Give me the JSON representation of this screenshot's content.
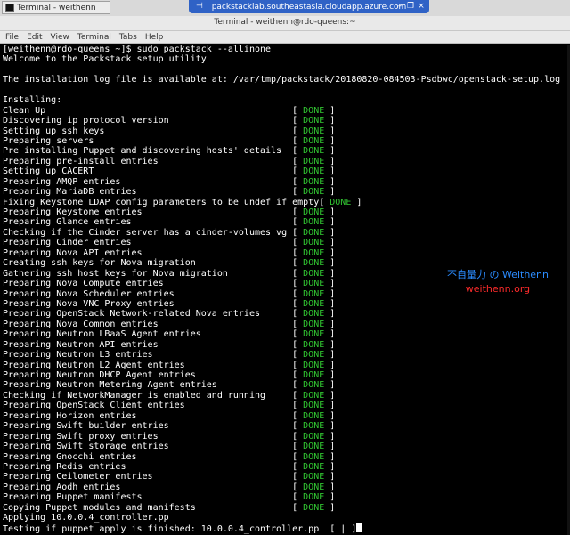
{
  "remote_bar": {
    "taskbar_label": "Terminal - weithenn",
    "title": "packstacklab.southeastasia.cloudapp.azure.com",
    "pin_glyph": "⊣",
    "controls": [
      "–",
      "❐",
      "×"
    ]
  },
  "window": {
    "title": "Terminal - weithenn@rdo-queens:~",
    "menu": [
      "File",
      "Edit",
      "View",
      "Terminal",
      "Tabs",
      "Help"
    ]
  },
  "terminal": {
    "done_tag": "DONE",
    "intro": [
      "[weithenn@rdo-queens ~]$ sudo packstack --allinone",
      "Welcome to the Packstack setup utility",
      "",
      "The installation log file is available at: /var/tmp/packstack/20180820-084503-Psdbwc/openstack-setup.log",
      "",
      "Installing:"
    ],
    "steps": [
      "Clean Up",
      "Discovering ip protocol version",
      "Setting up ssh keys",
      "Preparing servers",
      "Pre installing Puppet and discovering hosts' details",
      "Preparing pre-install entries",
      "Setting up CACERT",
      "Preparing AMQP entries",
      "Preparing MariaDB entries",
      "Fixing Keystone LDAP config parameters to be undef if empty",
      "Preparing Keystone entries",
      "Preparing Glance entries",
      "Checking if the Cinder server has a cinder-volumes vg",
      "Preparing Cinder entries",
      "Preparing Nova API entries",
      "Creating ssh keys for Nova migration",
      "Gathering ssh host keys for Nova migration",
      "Preparing Nova Compute entries",
      "Preparing Nova Scheduler entries",
      "Preparing Nova VNC Proxy entries",
      "Preparing OpenStack Network-related Nova entries",
      "Preparing Nova Common entries",
      "Preparing Neutron LBaaS Agent entries",
      "Preparing Neutron API entries",
      "Preparing Neutron L3 entries",
      "Preparing Neutron L2 Agent entries",
      "Preparing Neutron DHCP Agent entries",
      "Preparing Neutron Metering Agent entries",
      "Checking if NetworkManager is enabled and running",
      "Preparing OpenStack Client entries",
      "Preparing Horizon entries",
      "Preparing Swift builder entries",
      "Preparing Swift proxy entries",
      "Preparing Swift storage entries",
      "Preparing Gnocchi entries",
      "Preparing Redis entries",
      "Preparing Ceilometer entries",
      "Preparing Aodh entries",
      "Preparing Puppet manifests",
      "Copying Puppet modules and manifests"
    ],
    "tail": [
      "Applying 10.0.0.4_controller.pp",
      "Testing if puppet apply is finished: 10.0.0.4_controller.pp  [ | ]"
    ]
  },
  "watermark": {
    "line1": "不自量力 の Weithenn",
    "line2": "weithenn.org"
  },
  "colors": {
    "done_green": "#31c631",
    "rdp_blue": "#2f62c6",
    "watermark_blue": "#2b8cff",
    "watermark_red": "#ff2b2b"
  }
}
